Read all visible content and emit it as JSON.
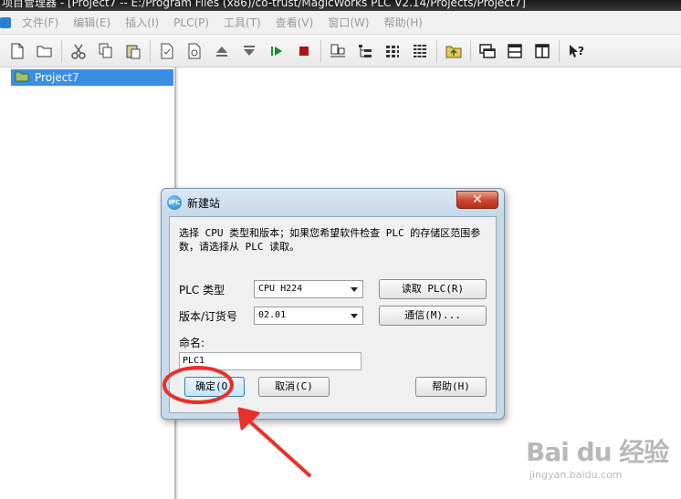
{
  "window": {
    "title": "项目管理器 - [Project7 -- E:/Program Files (x86)/co-trust/MagicWorks PLC V2.14/Projects/Project7]"
  },
  "menu": [
    {
      "label": "文件(F)"
    },
    {
      "label": "编辑(E)"
    },
    {
      "label": "插入(I)"
    },
    {
      "label": "PLC(P)"
    },
    {
      "label": "工具(T)"
    },
    {
      "label": "查看(V)"
    },
    {
      "label": "窗口(W)"
    },
    {
      "label": "帮助(H)"
    }
  ],
  "toolbar": {
    "buttons": [
      {
        "icon": "new-file-icon"
      },
      {
        "icon": "open-folder-icon"
      },
      {
        "icon": "cut-icon"
      },
      {
        "icon": "copy-icon"
      },
      {
        "icon": "paste-icon"
      },
      {
        "icon": "document-check-icon"
      },
      {
        "icon": "document-gear-icon"
      },
      {
        "icon": "upload-icon"
      },
      {
        "icon": "download-icon"
      },
      {
        "icon": "run-icon"
      },
      {
        "icon": "stop-icon"
      },
      {
        "icon": "station-icon"
      },
      {
        "icon": "tree-view-icon"
      },
      {
        "icon": "grid-view-icon"
      },
      {
        "icon": "list-view-icon"
      },
      {
        "icon": "folder-up-icon"
      },
      {
        "icon": "windows-icon"
      },
      {
        "icon": "panel-icon"
      },
      {
        "icon": "split-panel-icon"
      },
      {
        "icon": "help-cursor-icon"
      }
    ]
  },
  "tree": {
    "project": "Project7"
  },
  "dialog": {
    "title": "新建站",
    "icon_text": "IPC",
    "close": "✕",
    "description": "选择 CPU 类型和版本；如果您希望软件检查 PLC 的存储区范围参数，请选择从 PLC 读取。",
    "plc_type_label": "PLC 类型",
    "plc_type_value": "CPU H224",
    "version_label": "版本/订货号",
    "version_value": "02.01",
    "read_plc_button": "读取 PLC(R)",
    "comm_button": "通信(M)...",
    "name_label": "命名:",
    "name_value": "PLC1",
    "ok_button": "确定(O)",
    "cancel_button": "取消(C)",
    "help_button": "帮助(H)"
  },
  "watermark": {
    "logo": "Bai du 经验",
    "url": "jingyan.baidu.com"
  },
  "colors": {
    "selection": "#3a8ee6",
    "annotation": "#e8312a",
    "dialog_frame": "#c8daea"
  }
}
